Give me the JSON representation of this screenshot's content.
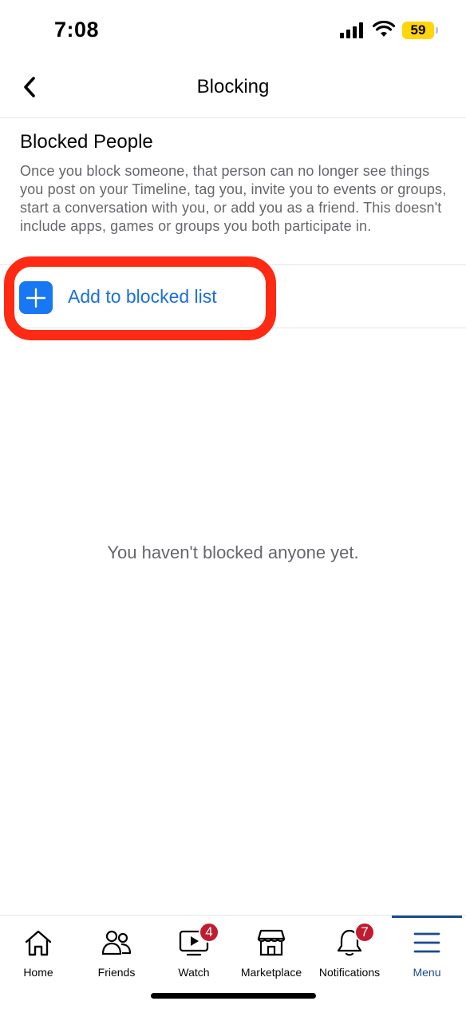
{
  "status_bar": {
    "time": "7:08",
    "battery_level": "59",
    "icons": [
      "signal-icon",
      "wifi-icon",
      "battery-icon"
    ],
    "battery_color": "#ffd60a"
  },
  "header": {
    "title": "Blocking",
    "back_icon": "chevron-left-icon"
  },
  "blocked_section": {
    "title": "Blocked People",
    "description": "Once you block someone, that person can no longer see things you post on your Timeline, tag you, invite you to events or groups, start a conversation with you, or add you as a friend. This doesn't include apps, games or groups you both participate in.",
    "add_label": "Add to blocked list",
    "add_icon": "plus-icon",
    "empty_message": "You haven't blocked anyone yet."
  },
  "tabs": [
    {
      "label": "Home",
      "icon": "home-icon"
    },
    {
      "label": "Friends",
      "icon": "friends-icon"
    },
    {
      "label": "Watch",
      "icon": "watch-icon",
      "badge": "4"
    },
    {
      "label": "Marketplace",
      "icon": "marketplace-icon"
    },
    {
      "label": "Notifications",
      "icon": "bell-icon",
      "badge": "7"
    },
    {
      "label": "Menu",
      "icon": "menu-icon",
      "active": true
    }
  ],
  "colors": {
    "accent": "#1877f2",
    "link": "#1b6fe0",
    "highlight": "#ff2a14",
    "badge": "#c21b2f",
    "active_tab": "#1b4a8f"
  }
}
